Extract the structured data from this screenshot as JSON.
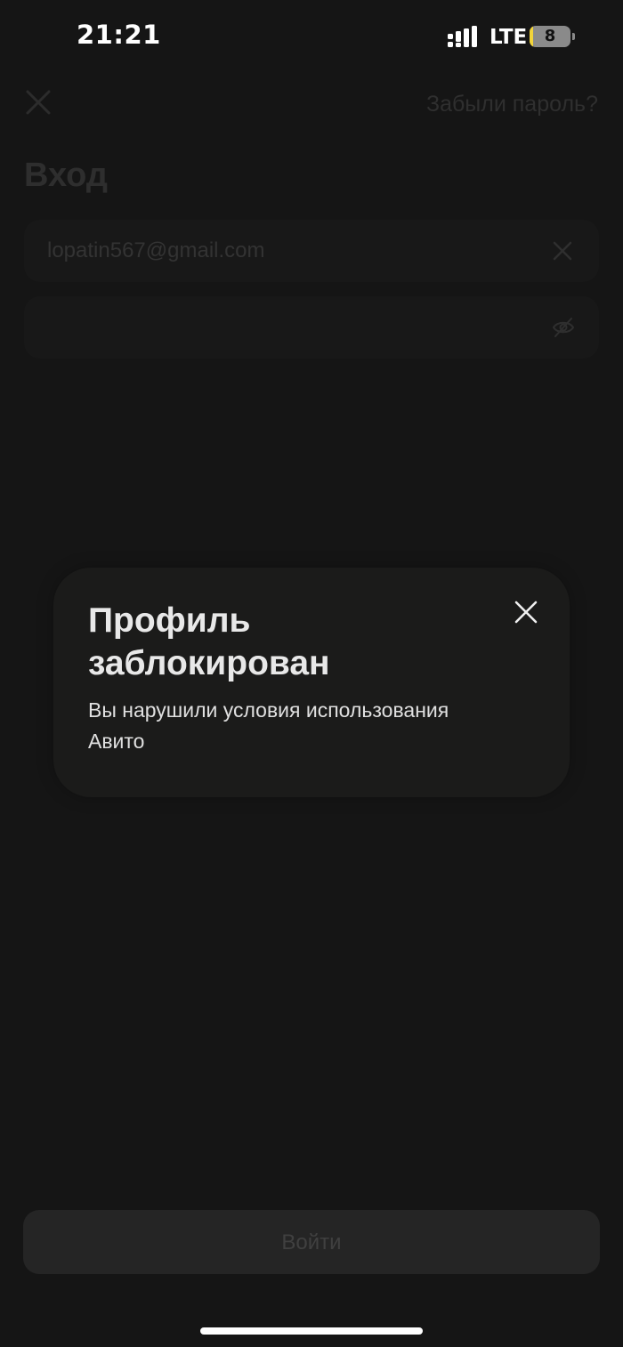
{
  "status_bar": {
    "time": "21:21",
    "network": "LTE",
    "battery_level": "8",
    "battery_fraction": 0.08,
    "icons": [
      "signal-icon",
      "battery-icon"
    ]
  },
  "header": {
    "close_icon": "close-icon",
    "forgot_password": "Забыли пароль?"
  },
  "login": {
    "title": "Вход",
    "email_value": "lopatin567@gmail.com",
    "email_clear_icon": "clear-icon",
    "password_value": "",
    "password_toggle_icon": "eye-off-icon",
    "submit_label": "Войти"
  },
  "modal": {
    "title": "Профиль заблокирован",
    "message": "Вы нарушили условия использования Авито",
    "close_icon": "close-icon"
  },
  "colors": {
    "background": "#151515",
    "modal_background": "#1b1b1a",
    "text_primary": "#e8e8e8",
    "battery_fill": "#f2d43a"
  }
}
